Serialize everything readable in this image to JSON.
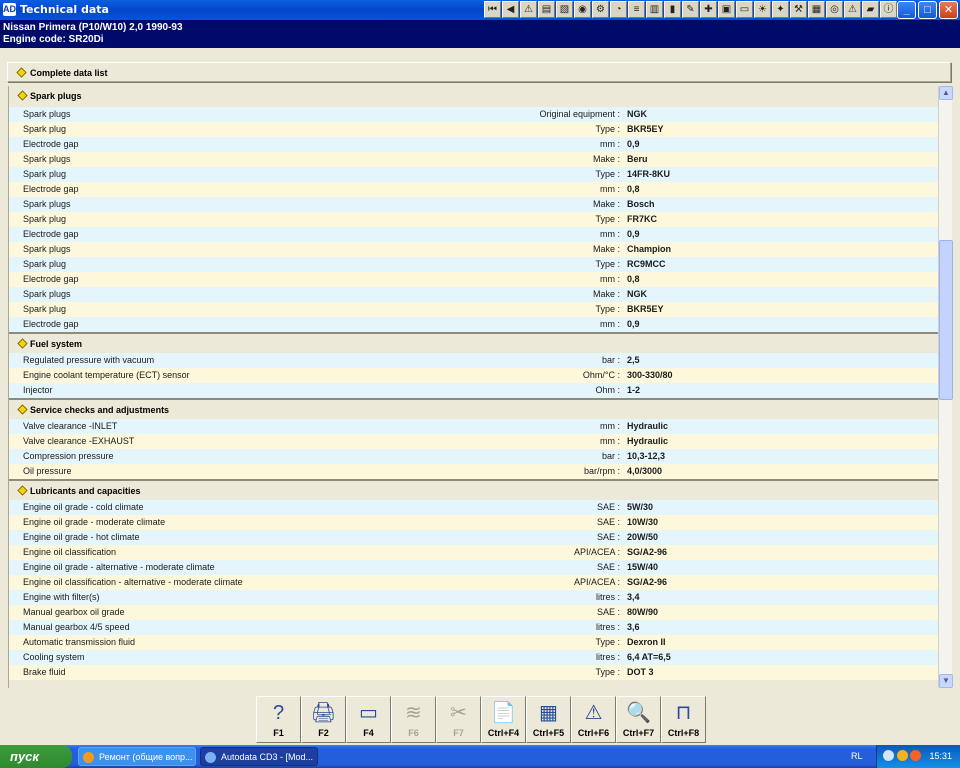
{
  "window": {
    "title": "Technical data",
    "app_icon": "AD",
    "minimize_glyph": "_",
    "maximize_glyph": "□",
    "close_glyph": "✕"
  },
  "vehicle": {
    "line1": "Nissan   Primera (P10/W10) 2,0   1990-93",
    "line2": "Engine code: SR20Di"
  },
  "complete_data_list": "Complete data list",
  "sections": [
    {
      "title": "Spark plugs",
      "rows": [
        {
          "name": "Spark plugs",
          "unit": "Original equipment :",
          "value": "NGK"
        },
        {
          "name": "Spark plug",
          "unit": "Type :",
          "value": "BKR5EY"
        },
        {
          "name": "Electrode gap",
          "unit": "mm :",
          "value": "0,9"
        },
        {
          "name": "Spark plugs",
          "unit": "Make :",
          "value": "Beru"
        },
        {
          "name": "Spark plug",
          "unit": "Type :",
          "value": "14FR-8KU"
        },
        {
          "name": "Electrode gap",
          "unit": "mm :",
          "value": "0,8"
        },
        {
          "name": "Spark plugs",
          "unit": "Make :",
          "value": "Bosch"
        },
        {
          "name": "Spark plug",
          "unit": "Type :",
          "value": "FR7KC"
        },
        {
          "name": "Electrode gap",
          "unit": "mm :",
          "value": "0,9"
        },
        {
          "name": "Spark plugs",
          "unit": "Make :",
          "value": "Champion"
        },
        {
          "name": "Spark plug",
          "unit": "Type :",
          "value": "RC9MCC"
        },
        {
          "name": "Electrode gap",
          "unit": "mm :",
          "value": "0,8"
        },
        {
          "name": "Spark plugs",
          "unit": "Make :",
          "value": "NGK"
        },
        {
          "name": "Spark plug",
          "unit": "Type :",
          "value": "BKR5EY"
        },
        {
          "name": "Electrode gap",
          "unit": "mm :",
          "value": "0,9"
        }
      ]
    },
    {
      "title": "Fuel system",
      "rows": [
        {
          "name": "Regulated pressure with vacuum",
          "unit": "bar :",
          "value": "2,5"
        },
        {
          "name": "Engine coolant temperature (ECT) sensor",
          "unit": "Ohm/°C :",
          "value": "300-330/80"
        },
        {
          "name": "Injector",
          "unit": "Ohm :",
          "value": "1-2"
        }
      ]
    },
    {
      "title": "Service checks and adjustments",
      "rows": [
        {
          "name": "Valve clearance  -INLET",
          "unit": "mm :",
          "value": "Hydraulic"
        },
        {
          "name": "Valve clearance  -EXHAUST",
          "unit": "mm :",
          "value": "Hydraulic"
        },
        {
          "name": "Compression pressure",
          "unit": "bar :",
          "value": "10,3-12,3"
        },
        {
          "name": "Oil pressure",
          "unit": "bar/rpm :",
          "value": "4,0/3000"
        }
      ]
    },
    {
      "title": "Lubricants and capacities",
      "rows": [
        {
          "name": "Engine oil grade - cold climate",
          "unit": "SAE :",
          "value": "5W/30"
        },
        {
          "name": "Engine oil grade - moderate climate",
          "unit": "SAE :",
          "value": "10W/30"
        },
        {
          "name": "Engine oil grade - hot climate",
          "unit": "SAE :",
          "value": "20W/50"
        },
        {
          "name": "Engine oil classification",
          "unit": "API/ACEA :",
          "value": "SG/A2-96"
        },
        {
          "name": "Engine oil grade - alternative - moderate climate",
          "unit": "SAE :",
          "value": "15W/40"
        },
        {
          "name": "Engine oil classification - alternative - moderate climate",
          "unit": "API/ACEA :",
          "value": "SG/A2-96"
        },
        {
          "name": "Engine with filter(s)",
          "unit": "litres :",
          "value": "3,4"
        },
        {
          "name": "Manual gearbox oil grade",
          "unit": "SAE :",
          "value": "80W/90"
        },
        {
          "name": "Manual gearbox 4/5 speed",
          "unit": "litres :",
          "value": "3,6"
        },
        {
          "name": "Automatic transmission fluid",
          "unit": "Type :",
          "value": "Dexron II"
        },
        {
          "name": "Cooling system",
          "unit": "litres :",
          "value": "6,4 AT=6,5"
        },
        {
          "name": "Brake fluid",
          "unit": "Type :",
          "value": "DOT 3"
        }
      ]
    }
  ],
  "toolbar_icons": [
    "first-icon",
    "prev-icon",
    "warning-icon",
    "document-icon",
    "chart-icon",
    "camera-icon",
    "engine-icon",
    "gauge-icon",
    "timing-icon",
    "list-icon",
    "battery-icon",
    "brush-icon",
    "wrench-icon",
    "car-icon",
    "window-icon",
    "lamp-icon",
    "spark-icon",
    "tools-icon",
    "diagram-icon",
    "wheel-icon",
    "alert-icon",
    "car2-icon",
    "info-icon"
  ],
  "function_keys": [
    {
      "key": "F1",
      "icon": "help-icon",
      "glyph": "?",
      "enabled": true
    },
    {
      "key": "F2",
      "icon": "printer-icon",
      "glyph": "🖨",
      "enabled": true
    },
    {
      "key": "F4",
      "icon": "screen-icon",
      "glyph": "▭",
      "enabled": true
    },
    {
      "key": "F6",
      "icon": "notes-icon",
      "glyph": "≋",
      "enabled": false
    },
    {
      "key": "F7",
      "icon": "tools-icon",
      "glyph": "✂",
      "enabled": false
    },
    {
      "key": "Ctrl+F4",
      "icon": "document-icon",
      "glyph": "📄",
      "enabled": true
    },
    {
      "key": "Ctrl+F5",
      "icon": "calculator-icon",
      "glyph": "▦",
      "enabled": true
    },
    {
      "key": "Ctrl+F6",
      "icon": "warning-card-icon",
      "glyph": "⚠",
      "enabled": true
    },
    {
      "key": "Ctrl+F7",
      "icon": "search-icon",
      "glyph": "🔍",
      "enabled": true
    },
    {
      "key": "Ctrl+F8",
      "icon": "lift-icon",
      "glyph": "⊓",
      "enabled": true
    }
  ],
  "taskbar": {
    "start_label": "пуск",
    "tasks": [
      {
        "label": "Ремонт (общие вопр...",
        "color": "#3e91ea"
      },
      {
        "label": "Autodata CD3 - [Mod...",
        "color": "#1c3fa0"
      }
    ],
    "language": "RL",
    "clock": "15:31"
  },
  "colors": {
    "row_odd": "#e4f5fc",
    "row_even": "#fdf8dc",
    "header_bg": "#000a6b",
    "section_diamond": "#f2d30e"
  }
}
